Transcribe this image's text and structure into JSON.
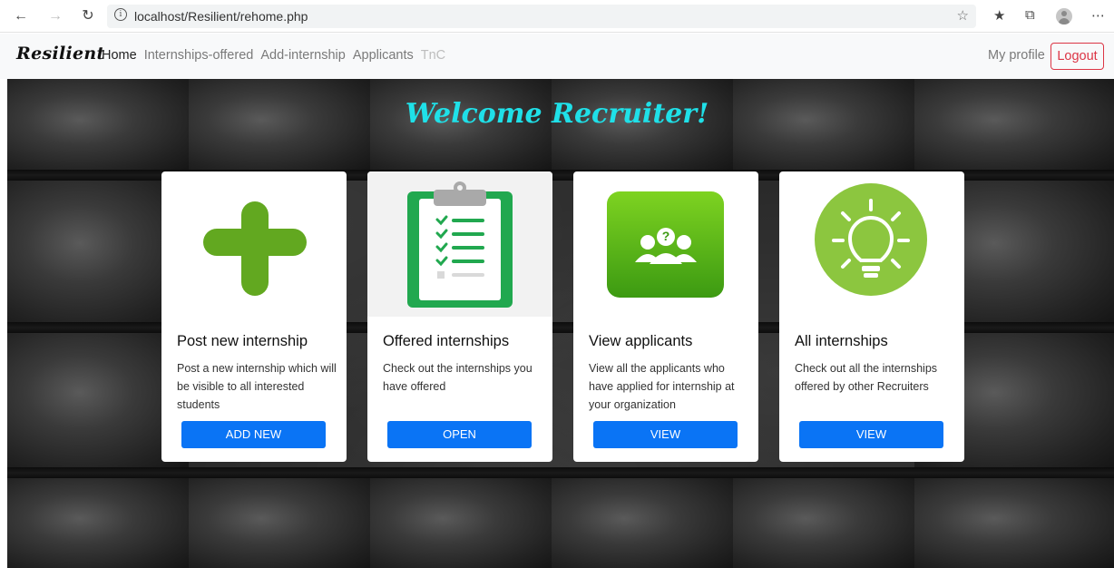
{
  "browser": {
    "url": "localhost/Resilient/rehome.php"
  },
  "navbar": {
    "brand": "Resilient",
    "links": [
      {
        "label": "Home",
        "state": "active"
      },
      {
        "label": "Internships-offered",
        "state": "normal"
      },
      {
        "label": "Add-internship",
        "state": "normal"
      },
      {
        "label": "Applicants",
        "state": "normal"
      },
      {
        "label": "TnC",
        "state": "disabled"
      }
    ],
    "my_profile": "My profile",
    "logout": "Logout"
  },
  "welcome": "Welcome Recruiter!",
  "cards": [
    {
      "title": "Post new internship",
      "text": "Post a new internship which will be visible to all interested students",
      "button": "ADD NEW",
      "icon": "plus-icon"
    },
    {
      "title": "Offered internships",
      "text": "Check out the internships you have offered",
      "button": "OPEN",
      "icon": "clipboard-checklist-icon"
    },
    {
      "title": "View applicants",
      "text": "View all the applicants who have applied for internship at your organization",
      "button": "VIEW",
      "icon": "applicants-group-icon"
    },
    {
      "title": "All internships",
      "text": "Check out all the internships offered by other Recruiters",
      "button": "VIEW",
      "icon": "lightbulb-icon"
    }
  ],
  "colors": {
    "accent_cyan": "#1fe0e8",
    "button_blue": "#0a74f5",
    "logout_red": "#dc3545",
    "icon_green": "#62a820"
  }
}
